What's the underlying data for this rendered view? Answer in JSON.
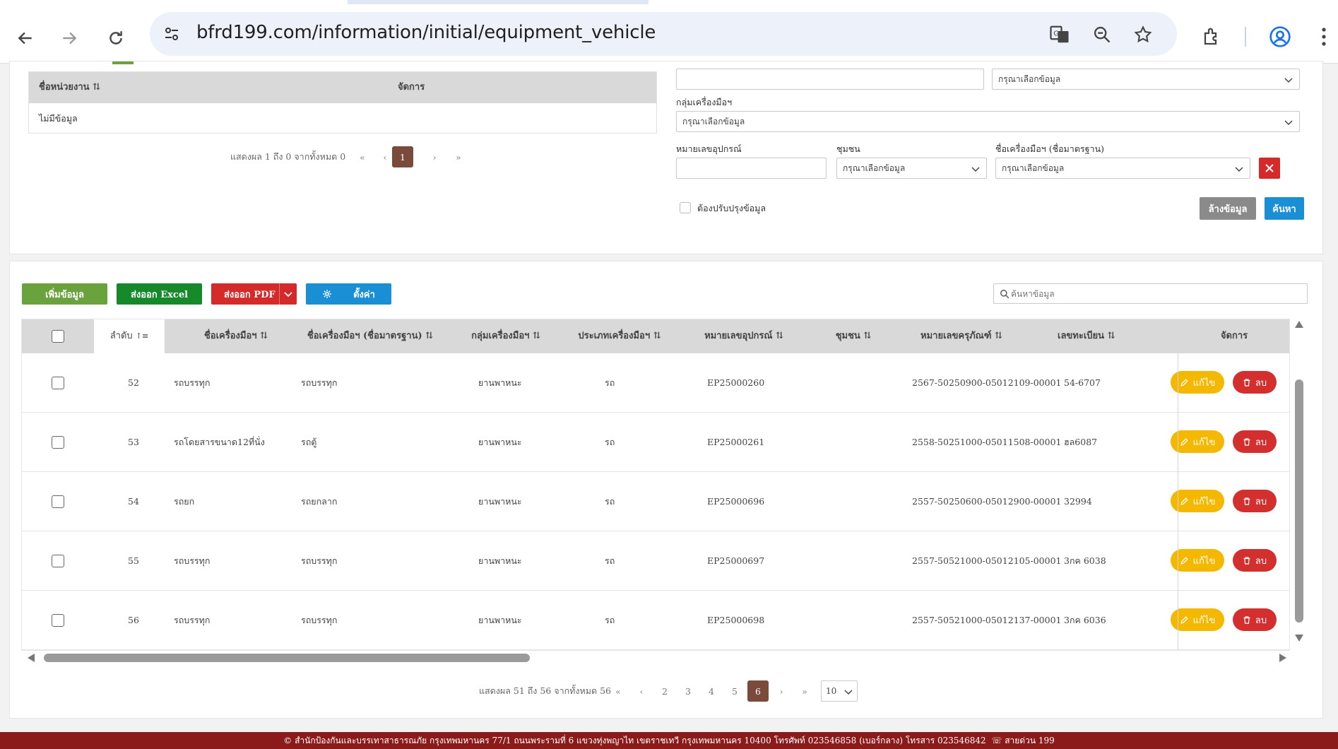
{
  "browser": {
    "url": "bfrd199.com/information/initial/equipment_vehicle"
  },
  "left_table": {
    "col_unit": "ชื่อหน่วยงาน",
    "col_manage": "จัดการ",
    "empty_text": "ไม่มีข้อมูล",
    "pagination_text": "แสดงผล 1 ถึง 0 จากทั้งหมด 0",
    "current_page": "1"
  },
  "filters": {
    "top_select_placeholder": "กรุณาเลือกข้อมูล",
    "group_label": "กลุ่มเครื่องมือฯ",
    "group_placeholder": "กรุณาเลือกข้อมูล",
    "equip_no_label": "หมายเลขอุปกรณ์",
    "community_label": "ชุมชน",
    "community_placeholder": "กรุณาเลือกข้อมูล",
    "std_name_label": "ชื่อเครื่องมือฯ (ชื่อมาตรฐาน)",
    "std_name_placeholder": "กรุณาเลือกข้อมูล",
    "update_checkbox_label": "ต้องปรับปรุงข้อมูล",
    "clear_button": "ล้างข้อมูล",
    "search_button": "ค้นหา"
  },
  "toolbar": {
    "add_button": "เพิ่มข้อมูล",
    "excel_button": "ส่งออก Excel",
    "pdf_button": "ส่งออก PDF",
    "settings_button": "ตั้งค่า",
    "search_placeholder": "ค้นหาข้อมูล"
  },
  "grid": {
    "columns": {
      "order": "ลำดับ",
      "name": "ชื่อเครื่องมือฯ",
      "std_name": "ชื่อเครื่องมือฯ (ชื่อมาตรฐาน)",
      "group": "กลุ่มเครื่องมือฯ",
      "type": "ประเภทเครื่องมือฯ",
      "equip_no": "หมายเลขอุปกรณ์",
      "community": "ชุมชน",
      "asset_no": "หมายเลขครุภัณฑ์",
      "reg_no": "เลขทะเบียน",
      "manage": "จัดการ"
    },
    "edit_label": "แก้ไข",
    "delete_label": "ลบ",
    "rows": [
      {
        "order": "52",
        "name": "รถบรรทุก",
        "std_name": "รถบรรทุก",
        "group": "ยานพาหนะ",
        "type": "รถ",
        "equip_no": "EP25000260",
        "community": "",
        "asset_no": "2567-50250900-05012109-00001",
        "reg_no": "54-6707"
      },
      {
        "order": "53",
        "name": "รถโดยสารขนาด12ที่นั่ง",
        "std_name": "รถตู้",
        "group": "ยานพาหนะ",
        "type": "รถ",
        "equip_no": "EP25000261",
        "community": "",
        "asset_no": "2558-50251000-05011508-00001",
        "reg_no": "ฮล6087"
      },
      {
        "order": "54",
        "name": "รถยก",
        "std_name": "รถยกลาก",
        "group": "ยานพาหนะ",
        "type": "รถ",
        "equip_no": "EP25000696",
        "community": "",
        "asset_no": "2557-50250600-05012900-00001",
        "reg_no": "32994"
      },
      {
        "order": "55",
        "name": "รถบรรทุก",
        "std_name": "รถบรรทุก",
        "group": "ยานพาหนะ",
        "type": "รถ",
        "equip_no": "EP25000697",
        "community": "",
        "asset_no": "2557-50521000-05012105-00001",
        "reg_no": "3กค 6038"
      },
      {
        "order": "56",
        "name": "รถบรรทุก",
        "std_name": "รถบรรทุก",
        "group": "ยานพาหนะ",
        "type": "รถ",
        "equip_no": "EP25000698",
        "community": "",
        "asset_no": "2557-50521000-05012137-00001",
        "reg_no": "3กค 6036"
      }
    ]
  },
  "pagination": {
    "text": "แสดงผล 51 ถึง 56 จากทั้งหมด 56",
    "pages": [
      "2",
      "3",
      "4",
      "5",
      "6"
    ],
    "current": "6",
    "page_size": "10"
  },
  "footer": {
    "text": "© สำนักป้องกันและบรรเทาสาธารณภัย กรุงเทพมหานคร 77/1 ถนนพระรามที่ 6 แขวงทุ่งพญาไท เขตราชเทวี กรุงเทพมหานคร 10400 โทรศัพท์ 023546858 (เบอร์กลาง) โทรสาร 023546842",
    "hotline": "สายด่วน 199"
  },
  "colors": {
    "add": "#6aa33d",
    "excel": "#168a2a",
    "pdf": "#d42a2a",
    "settings": "#1a8fd6",
    "search": "#1a8fd6",
    "clear": "#8a8a8a",
    "edit": "#f5b800",
    "delete": "#d32f2f",
    "footer": "#8b1a1a"
  }
}
